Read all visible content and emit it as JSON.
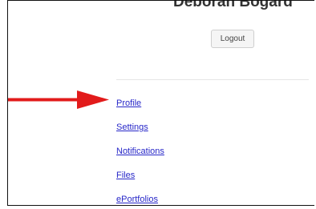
{
  "user": {
    "name": "Deborah Bogard"
  },
  "logout_label": "Logout",
  "nav": {
    "items": [
      {
        "label": "Profile"
      },
      {
        "label": "Settings"
      },
      {
        "label": "Notifications"
      },
      {
        "label": "Files"
      },
      {
        "label": "ePortfolios"
      }
    ]
  },
  "colors": {
    "arrow": "#e21b1b",
    "link": "#2727c8"
  }
}
